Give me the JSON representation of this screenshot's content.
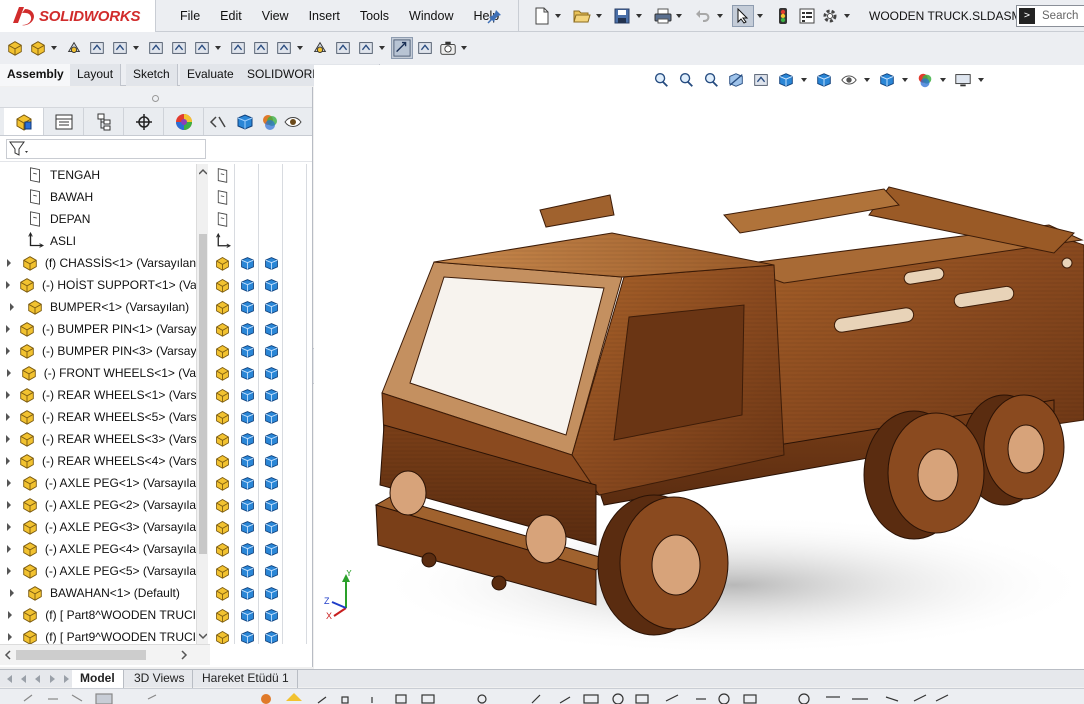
{
  "app": {
    "brand": "SOLIDWORKS",
    "document_title": "WOODEN TRUCK.SLDASM",
    "search_placeholder": "Search"
  },
  "menu": [
    "File",
    "Edit",
    "View",
    "Insert",
    "Tools",
    "Window",
    "Help"
  ],
  "main_toolbar": [
    "new-icon",
    "open-icon",
    "save-icon",
    "print-icon",
    "undo-icon",
    "select-icon",
    "rebuild-icon",
    "file-properties-icon",
    "options-icon"
  ],
  "command_manager": {
    "tools": [
      "edit-component-icon",
      "insert-components-icon",
      "mate-icon",
      "component-preview-icon",
      "linear-pattern-icon",
      "smart-fasteners-icon",
      "move-component-icon",
      "show-hidden-icon",
      "assembly-features-icon",
      "reference-geometry-icon",
      "new-motion-study-icon",
      "bill-of-materials-icon",
      "exploded-view-icon",
      "explode-line-icon",
      "instant3d-icon",
      "update-speedpak-icon",
      "snapshot-icon"
    ],
    "tabs": [
      {
        "label": "Assembly",
        "active": true
      },
      {
        "label": "Layout",
        "active": false
      },
      {
        "label": "Sketch",
        "active": false
      },
      {
        "label": "Evaluate",
        "active": false
      },
      {
        "label": "SOLIDWORKS Add-Ins",
        "active": false
      }
    ]
  },
  "feature_manager": {
    "pane_tabs": [
      "featuremanager-icon",
      "propertymanager-icon",
      "configurationmanager-icon",
      "dimxpertmanager-icon",
      "displaymanager-icon"
    ],
    "display_pane_tabs": [
      "collapse-icon",
      "appearance-cube-icon",
      "scene-icon",
      "visibility-eye-icon"
    ],
    "tree": [
      {
        "label": "TENGAH",
        "type": "plane",
        "expandable": false
      },
      {
        "label": "BAWAH",
        "type": "plane",
        "expandable": false
      },
      {
        "label": "DEPAN",
        "type": "plane",
        "expandable": false
      },
      {
        "label": "ASLI",
        "type": "origin",
        "expandable": false
      },
      {
        "label": "(f) CHASSİS<1> (Varsayılan",
        "type": "part",
        "expandable": true
      },
      {
        "label": "(-) HOİST SUPPORT<1> (Va",
        "type": "part",
        "expandable": true
      },
      {
        "label": "BUMPER<1> (Varsayılan)",
        "type": "part",
        "expandable": true
      },
      {
        "label": "(-) BUMPER PIN<1> (Varsay",
        "type": "part",
        "expandable": true
      },
      {
        "label": "(-) BUMPER PIN<3> (Varsay",
        "type": "part",
        "expandable": true
      },
      {
        "label": "(-) FRONT WHEELS<1> (Va",
        "type": "part",
        "expandable": true
      },
      {
        "label": "(-) REAR WHEELS<1> (Vars",
        "type": "part",
        "expandable": true
      },
      {
        "label": "(-) REAR WHEELS<5> (Vars",
        "type": "part",
        "expandable": true
      },
      {
        "label": "(-) REAR WHEELS<3> (Vars",
        "type": "part",
        "expandable": true
      },
      {
        "label": "(-) REAR WHEELS<4> (Vars",
        "type": "part",
        "expandable": true
      },
      {
        "label": "(-) AXLE PEG<1> (Varsayıla",
        "type": "part",
        "expandable": true
      },
      {
        "label": "(-) AXLE PEG<2> (Varsayıla",
        "type": "part",
        "expandable": true
      },
      {
        "label": "(-) AXLE PEG<3> (Varsayıla",
        "type": "part",
        "expandable": true
      },
      {
        "label": "(-) AXLE PEG<4> (Varsayıla",
        "type": "part",
        "expandable": true
      },
      {
        "label": "(-) AXLE PEG<5> (Varsayıla",
        "type": "part",
        "expandable": true
      },
      {
        "label": "BAWAHAN<1> (Default)",
        "type": "part",
        "expandable": true
      },
      {
        "label": "(f) [ Part8^WOODEN TRUCI",
        "type": "part",
        "expandable": true
      },
      {
        "label": "(f) [ Part9^WOODEN TRUCI",
        "type": "part",
        "expandable": true
      }
    ]
  },
  "viewport": {
    "heads_up_toolbar": [
      "zoom-to-fit-icon",
      "zoom-to-area-icon",
      "previous-view-icon",
      "section-view-icon",
      "dynamic-annotation-icon",
      "view-orientation-icon",
      "display-style-icon",
      "hide-show-items-icon",
      "edit-appearance-icon",
      "apply-scene-icon",
      "view-settings-icon"
    ],
    "triad_axes": [
      "Y",
      "Z",
      "X"
    ]
  },
  "bottom_tabs": [
    {
      "label": "Model",
      "active": true
    },
    {
      "label": "3D Views",
      "active": false
    },
    {
      "label": "Hareket Etüdü 1",
      "active": false
    }
  ],
  "colors": {
    "brand_red": "#d12c2c",
    "wood_dark": "#5a2e12",
    "wood_mid": "#8a4a1f",
    "wood_light": "#b87a44",
    "part_yellow": "#f2c230",
    "appearance_blue": "#2a6fd6",
    "scene_orange": "#e07a2a"
  }
}
